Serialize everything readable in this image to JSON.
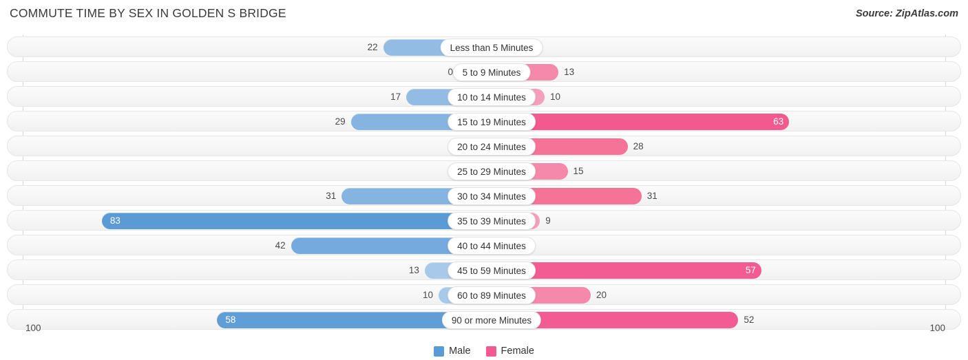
{
  "title": "COMMUTE TIME BY SEX IN GOLDEN S BRIDGE",
  "source": "Source: ZipAtlas.com",
  "axis": {
    "left_max": "100",
    "right_max": "100"
  },
  "legend": [
    {
      "name": "male",
      "label": "Male",
      "color": "#5b9bd5"
    },
    {
      "name": "female",
      "label": "Female",
      "color": "#f2598f"
    }
  ],
  "chart_data": {
    "type": "bar",
    "orientation": "horizontal-diverging",
    "title": "COMMUTE TIME BY SEX IN GOLDEN S BRIDGE",
    "xlabel": "",
    "ylabel": "",
    "xlim": [
      100,
      100
    ],
    "grid": false,
    "legend_position": "bottom-center",
    "categories": [
      "Less than 5 Minutes",
      "5 to 9 Minutes",
      "10 to 14 Minutes",
      "15 to 19 Minutes",
      "20 to 24 Minutes",
      "25 to 29 Minutes",
      "30 to 34 Minutes",
      "35 to 39 Minutes",
      "40 to 44 Minutes",
      "45 to 59 Minutes",
      "60 to 89 Minutes",
      "90 or more Minutes"
    ],
    "series": [
      {
        "name": "Male",
        "color": "#5b9bd5",
        "values": [
          22,
          0,
          17,
          29,
          4,
          0,
          31,
          83,
          42,
          13,
          10,
          58
        ]
      },
      {
        "name": "Female",
        "color": "#f2598f",
        "values": [
          0,
          13,
          10,
          63,
          28,
          15,
          31,
          9,
          0,
          57,
          20,
          52
        ]
      }
    ]
  }
}
